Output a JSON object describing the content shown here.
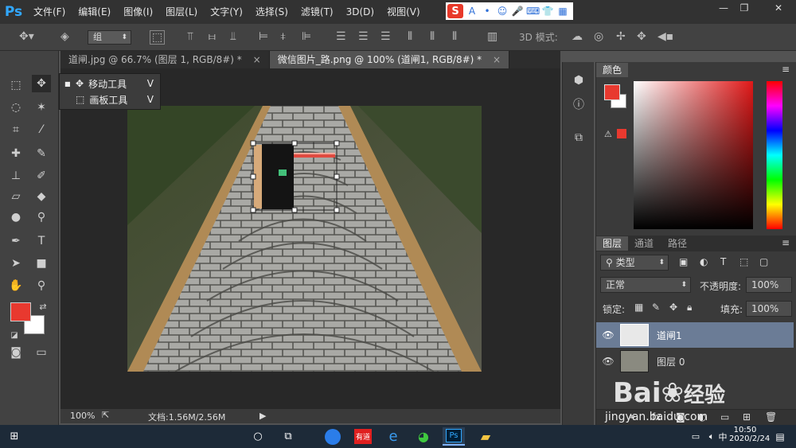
{
  "app": {
    "logo": "Ps"
  },
  "menu": [
    "文件(F)",
    "编辑(E)",
    "图像(I)",
    "图层(L)",
    "文字(Y)",
    "选择(S)",
    "滤镜(T)",
    "3D(D)",
    "视图(V)"
  ],
  "window_controls": {
    "minimize": "—",
    "restore": "❐",
    "close": "✕"
  },
  "ime": {
    "logo": "S",
    "icons": [
      "A",
      "•",
      "☺",
      "🎤",
      "⌨",
      "👕",
      "▦"
    ]
  },
  "options_bar": {
    "auto_select_value": "组",
    "mode_3d_label": "3D 模式:"
  },
  "tool_flyout": {
    "items": [
      {
        "label": "移动工具",
        "key": "V"
      },
      {
        "label": "画板工具",
        "key": "V"
      }
    ]
  },
  "tabs": [
    {
      "label": "道闸.jpg @ 66.7% (图层 1, RGB/8#) *",
      "close": "×"
    },
    {
      "label": "微信图片_路.png @ 100% (道闸1, RGB/8#) *",
      "close": "×"
    }
  ],
  "status": {
    "zoom": "100%",
    "doc": "文档:1.56M/2.56M"
  },
  "color_panel": {
    "title": "颜色",
    "fg_color": "#e8392f",
    "bg_color": "#ffffff"
  },
  "layers_panel": {
    "tabs": [
      "图层",
      "通道",
      "路径"
    ],
    "filter_kind": "类型",
    "blend_mode": "正常",
    "opacity_label": "不透明度:",
    "opacity_value": "100%",
    "lock_label": "锁定:",
    "fill_label": "填充:",
    "fill_value": "100%",
    "layers": [
      {
        "name": "道闸1",
        "selected": true
      },
      {
        "name": "图层 0",
        "selected": false
      }
    ]
  },
  "watermark": {
    "brand": "Bai",
    "brand2": "经验",
    "url": "jingyan.baidu.com"
  },
  "taskbar": {
    "time": "10:50",
    "date": "2020/2/24",
    "ime": "中",
    "app_icons": [
      "sogou-browser",
      "youdao",
      "edge",
      "wechat",
      "photoshop",
      "explorer"
    ],
    "youdao_label": "有道",
    "ps_label": "Ps"
  }
}
